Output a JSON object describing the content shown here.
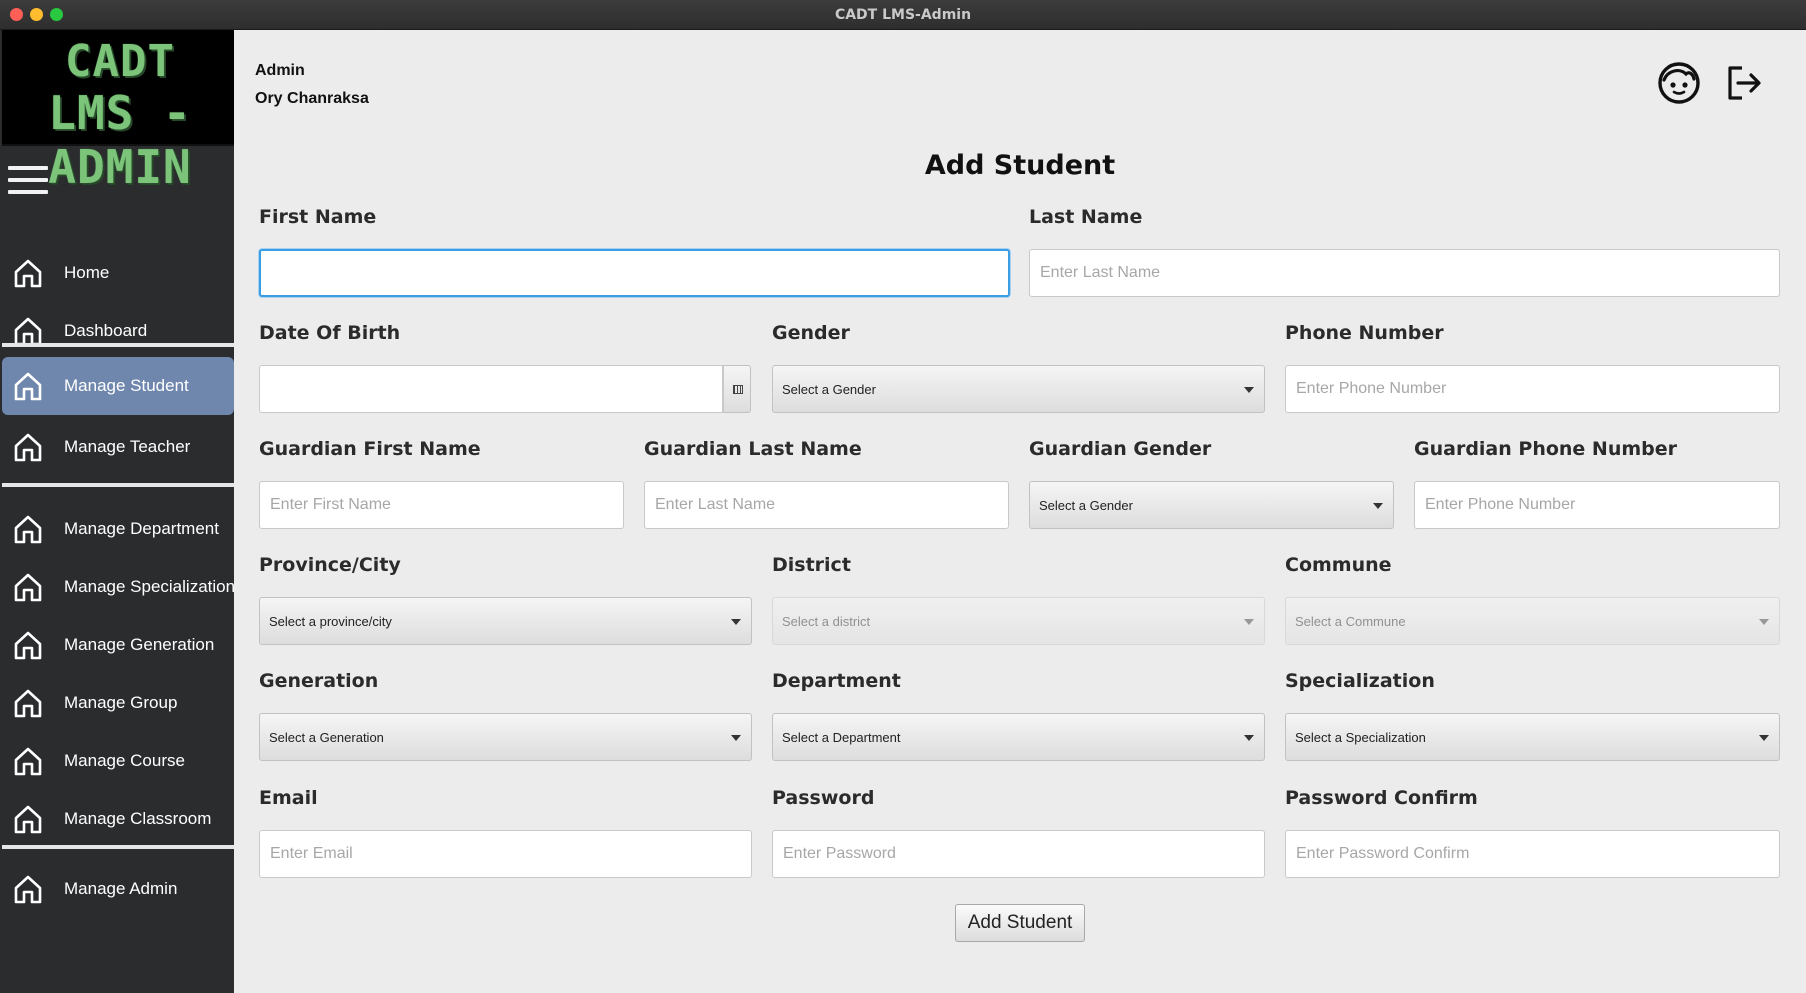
{
  "window": {
    "title": "CADT LMS-Admin"
  },
  "logo": {
    "line1": "CADT",
    "line2": "LMS - ADMIN"
  },
  "sidebar": {
    "items": [
      {
        "label": "Home",
        "icon": "home-icon"
      },
      {
        "label": "Dashboard",
        "icon": "home-icon"
      },
      {
        "label": "Manage Student",
        "icon": "home-icon",
        "active": true
      },
      {
        "label": "Manage Teacher",
        "icon": "home-icon"
      },
      {
        "label": "Manage Department",
        "icon": "home-icon"
      },
      {
        "label": "Manage Specialization",
        "icon": "home-icon"
      },
      {
        "label": "Manage Generation",
        "icon": "home-icon"
      },
      {
        "label": "Manage Group",
        "icon": "home-icon"
      },
      {
        "label": "Manage Course",
        "icon": "home-icon"
      },
      {
        "label": "Manage Classroom",
        "icon": "home-icon"
      },
      {
        "label": "Manage Admin",
        "icon": "home-icon"
      }
    ]
  },
  "header": {
    "role": "Admin",
    "user_name": "Ory Chanraksa",
    "profile_icon": "face-icon",
    "logout_icon": "logout-icon"
  },
  "form": {
    "title": "Add Student",
    "first_name": {
      "label": "First Name",
      "value": "",
      "placeholder": ""
    },
    "last_name": {
      "label": "Last Name",
      "value": "",
      "placeholder": "Enter Last Name"
    },
    "date_of_birth": {
      "label": "Date Of Birth",
      "value": ""
    },
    "gender": {
      "label": "Gender",
      "selected": "Select a Gender"
    },
    "phone_number": {
      "label": "Phone Number",
      "placeholder": "Enter Phone Number"
    },
    "guardian_first_name": {
      "label": "Guardian First  Name",
      "placeholder": "Enter First Name"
    },
    "guardian_last_name": {
      "label": "Guardian Last Name",
      "placeholder": "Enter Last Name"
    },
    "guardian_gender": {
      "label": "Guardian Gender",
      "selected": "Select a Gender"
    },
    "guardian_phone_number": {
      "label": "Guardian Phone Number",
      "placeholder": "Enter Phone Number"
    },
    "province": {
      "label": "Province/City",
      "selected": "Select a province/city"
    },
    "district": {
      "label": "District",
      "selected": "Select a district",
      "disabled": true
    },
    "commune": {
      "label": "Commune",
      "selected": "Select a Commune",
      "disabled": true
    },
    "generation": {
      "label": "Generation",
      "selected": "Select a Generation"
    },
    "department": {
      "label": "Department",
      "selected": "Select a Department"
    },
    "specialization": {
      "label": "Specialization",
      "selected": "Select a Specialization"
    },
    "email": {
      "label": "Email",
      "placeholder": "Enter Email"
    },
    "password": {
      "label": "Password",
      "placeholder": "Enter Password"
    },
    "password_confirm": {
      "label": "Password Confirm",
      "placeholder": "Enter Password Confirm"
    },
    "submit_label": "Add Student"
  },
  "colors": {
    "sidebar_bg": "#2b2c2e",
    "active_item_bg": "#6f87ad",
    "logo_text": "#7bc47a",
    "focus_ring": "#3d9de3",
    "main_bg": "#ececec"
  }
}
